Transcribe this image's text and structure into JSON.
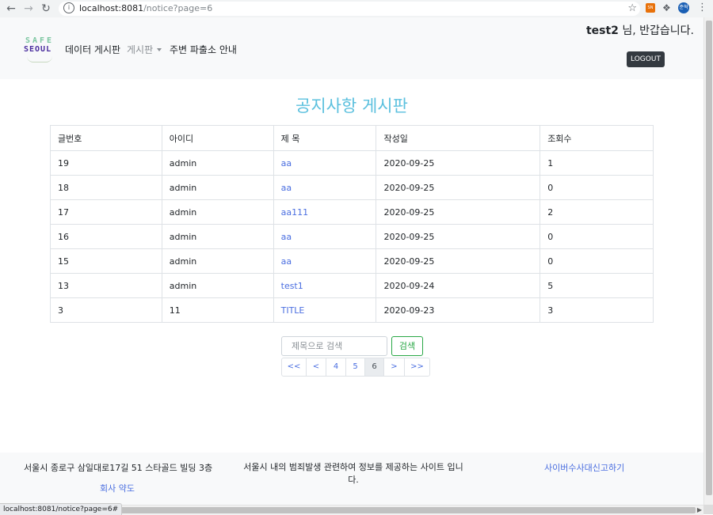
{
  "browser": {
    "url_host": "localhost:8081",
    "url_path": "/notice?page=6",
    "icons": {
      "back": "arrow-left-icon",
      "forward": "arrow-right-icon",
      "reload": "reload-icon",
      "info": "info-icon",
      "star": "star-icon",
      "extension": "extension-icon",
      "puzzle": "puzzle-icon",
      "profile": "profile-avatar",
      "menu": "kebab-menu-icon"
    },
    "profile_text": "준혁",
    "extension_text": "SN",
    "status_url": "localhost:8081/notice?page=6#"
  },
  "header": {
    "logo_line1": "SAFE",
    "logo_line2": "SEOUL",
    "nav_data": "데이터 게시판",
    "nav_board": "게시판",
    "nav_police": "주변 파출소 안내",
    "greeting_user": "test2",
    "greeting_text": " 님, 반갑습니다.",
    "logout_label": "LOGOUT"
  },
  "main": {
    "title": "공지사항 게시판",
    "columns": [
      "글번호",
      "아이디",
      "제 목",
      "작성일",
      "조회수"
    ],
    "rows": [
      {
        "no": "19",
        "id": "admin",
        "title": "aa",
        "date": "2020-09-25",
        "views": "1"
      },
      {
        "no": "18",
        "id": "admin",
        "title": "aa",
        "date": "2020-09-25",
        "views": "0"
      },
      {
        "no": "17",
        "id": "admin",
        "title": "aa111",
        "date": "2020-09-25",
        "views": "2"
      },
      {
        "no": "16",
        "id": "admin",
        "title": "aa",
        "date": "2020-09-25",
        "views": "0"
      },
      {
        "no": "15",
        "id": "admin",
        "title": "aa",
        "date": "2020-09-25",
        "views": "0"
      },
      {
        "no": "13",
        "id": "admin",
        "title": "test1",
        "date": "2020-09-24",
        "views": "5"
      },
      {
        "no": "3",
        "id": "11",
        "title": "TITLE",
        "date": "2020-09-23",
        "views": "3"
      }
    ],
    "search": {
      "placeholder": "제목으로 검색",
      "value": "",
      "button": "검색"
    },
    "pagination": {
      "first": "<<",
      "prev": "<",
      "pages": [
        "4",
        "5",
        "6"
      ],
      "current": "6",
      "next": ">",
      "last": ">>"
    }
  },
  "footer": {
    "address": "서울시 종로구 삼일대로17길 51 스타골드 빌딩 3층",
    "terms": "회사 약도",
    "description": "서울시 내의 범죄발생 관련하여 정보를 제공하는 사이트 입니다.",
    "cyber_report": "사이버수사대신고하기"
  }
}
